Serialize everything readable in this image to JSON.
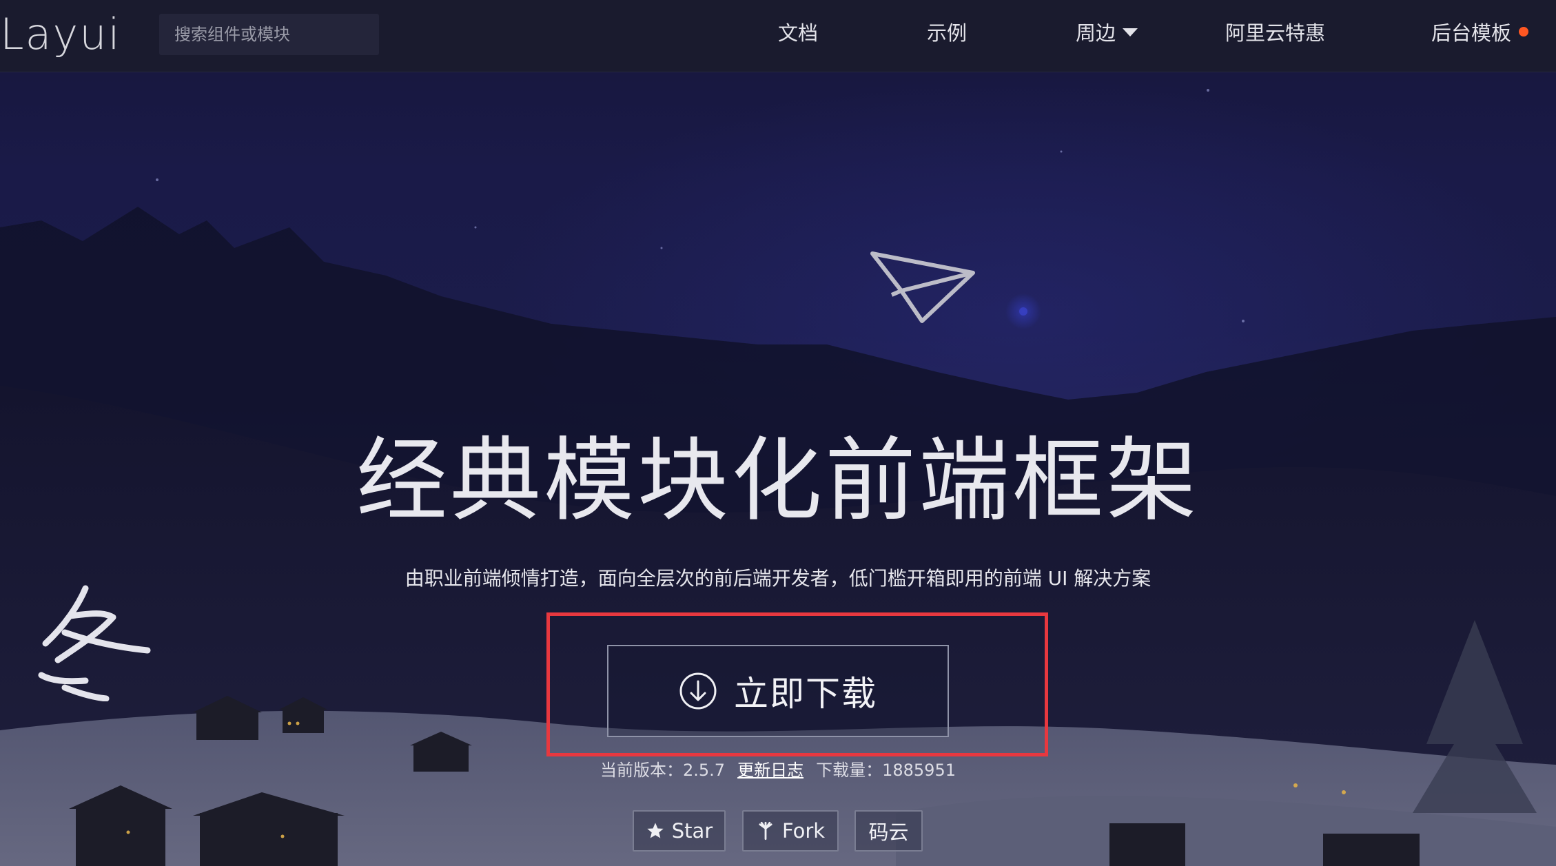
{
  "header": {
    "logo": "Layui",
    "search_placeholder": "搜索组件或模块",
    "nav": [
      {
        "label": "文档"
      },
      {
        "label": "示例"
      },
      {
        "label": "周边",
        "has_dropdown": true
      },
      {
        "label": "阿里云特惠"
      },
      {
        "label": "后台模板",
        "badge_color": "#ff5722"
      }
    ]
  },
  "hero": {
    "title": "经典模块化前端框架",
    "subtitle": "由职业前端倾情打造，面向全层次的前后端开发者，低门槛开箱即用的前端 UI 解决方案",
    "download_label": "立即下载",
    "version_label": "当前版本：2.5.7",
    "changelog_label": "更新日志",
    "downloads_label": "下载量：1885951"
  },
  "repo_buttons": {
    "star": "Star",
    "fork": "Fork",
    "gitee": "码云"
  },
  "colors": {
    "header_bg": "#1a1b2e",
    "highlight": "#e8383f",
    "badge": "#ff5722"
  },
  "icons": [
    "paper-plane-icon",
    "download-circle-icon",
    "star-icon",
    "fork-icon",
    "winter-glyph-icon",
    "caret-down-icon"
  ]
}
